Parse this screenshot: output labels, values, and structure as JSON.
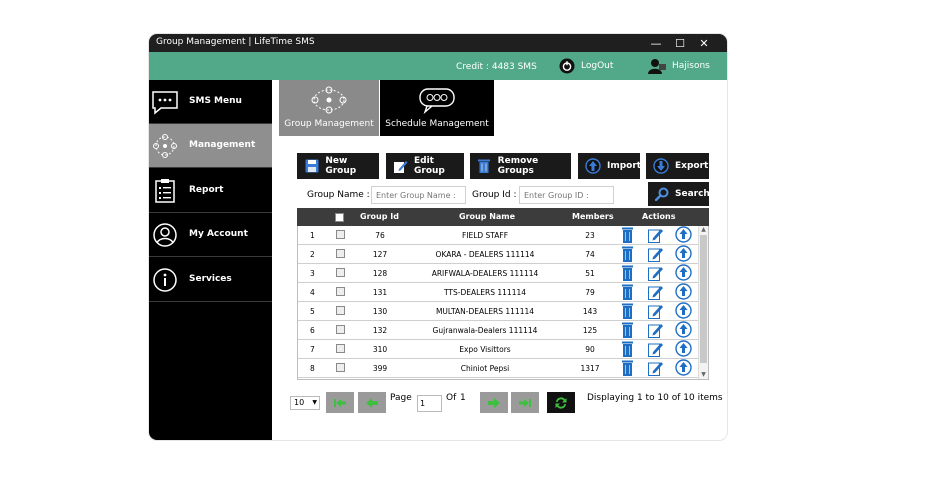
{
  "window": {
    "title": "Group Management | LifeTime SMS",
    "controls": {
      "minimize": "—",
      "maximize": "☐",
      "close": "✕"
    }
  },
  "topbar": {
    "credit": "Credit :  4483 SMS",
    "logout": "LogOut",
    "user": "Hajisons"
  },
  "sidebar": {
    "items": [
      {
        "label": "SMS Menu",
        "icon": "chat-dots-icon"
      },
      {
        "label": "Management",
        "icon": "group-network-icon",
        "active": true
      },
      {
        "label": "Report",
        "icon": "clipboard-list-icon"
      },
      {
        "label": "My Account",
        "icon": "user-circle-icon"
      },
      {
        "label": "Services",
        "icon": "info-circle-icon"
      }
    ]
  },
  "tabs": [
    {
      "label": "Group Management",
      "active": true
    },
    {
      "label": "Schedule Management"
    }
  ],
  "toolbar": {
    "new_group": "New Group",
    "edit_group": "Edit Group",
    "remove_groups": "Remove Groups",
    "import": "Import",
    "export": "Export",
    "search": "Search"
  },
  "filters": {
    "group_name_label": "Group Name :",
    "group_name_placeholder": "Enter Group Name :",
    "group_id_label": "Group Id :",
    "group_id_placeholder": "Enter Group ID :"
  },
  "grid": {
    "headers": {
      "group_id": "Group Id",
      "group_name": "Group Name",
      "members": "Members",
      "actions": "Actions"
    },
    "rows": [
      {
        "num": "1",
        "id": "76",
        "name": "FIELD STAFF",
        "members": "23"
      },
      {
        "num": "2",
        "id": "127",
        "name": "OKARA - DEALERS 111114",
        "members": "74"
      },
      {
        "num": "3",
        "id": "128",
        "name": "ARIFWALA-DEALERS 111114",
        "members": "51"
      },
      {
        "num": "4",
        "id": "131",
        "name": "TTS-DEALERS 111114",
        "members": "79"
      },
      {
        "num": "5",
        "id": "130",
        "name": "MULTAN-DEALERS 111114",
        "members": "143"
      },
      {
        "num": "6",
        "id": "132",
        "name": "Gujranwala-Dealers 111114",
        "members": "125"
      },
      {
        "num": "7",
        "id": "310",
        "name": "Expo Visittors",
        "members": "90"
      },
      {
        "num": "8",
        "id": "399",
        "name": "Chiniot Pepsi",
        "members": "1317"
      }
    ]
  },
  "pager": {
    "page_size": "10",
    "page_label": "Page",
    "page_value": "1",
    "of_label": "Of",
    "total_pages": "1",
    "display": "Displaying 1 to 10 of 10 items"
  },
  "colors": {
    "accent": "#52a98a",
    "dark": "#1a1a1a",
    "sidebar_active": "#8f8f8f",
    "icon_blue": "#1e6fc4",
    "pager_green": "#3fbf3f"
  }
}
